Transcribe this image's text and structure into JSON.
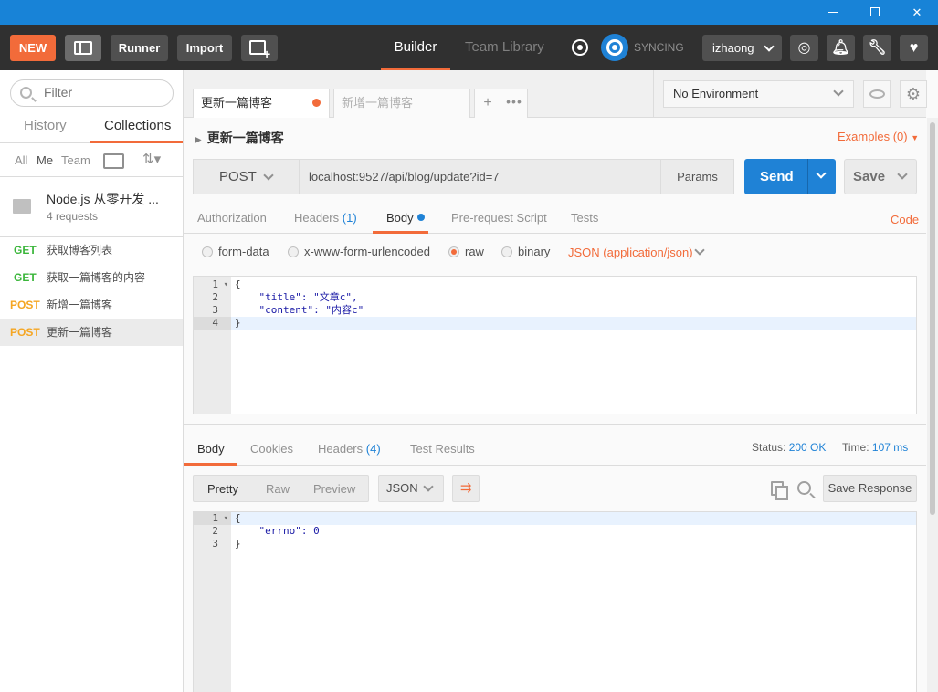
{
  "window": {
    "controls": [
      "minimize",
      "maximize",
      "close"
    ],
    "close_glyph": "✕"
  },
  "header": {
    "new_label": "NEW",
    "runner_label": "Runner",
    "import_label": "Import",
    "nav": {
      "builder": "Builder",
      "team_library": "Team Library"
    },
    "sync_label": "SYNCING",
    "user": "izhaong",
    "icons": [
      "layout-icon",
      "new-window-icon",
      "interceptor-icon",
      "sync-icon",
      "satellite-icon",
      "bell-icon",
      "wrench-icon",
      "heart-icon"
    ],
    "accent_color": "#f26b3a"
  },
  "sidebar": {
    "filter_placeholder": "Filter",
    "tabs": {
      "history": "History",
      "collections": "Collections"
    },
    "filters": {
      "all": "All",
      "me": "Me",
      "team": "Team"
    },
    "collection": {
      "name": "Node.js 从零开发 ...",
      "count": "4 requests"
    },
    "requests": [
      {
        "method": "GET",
        "name": "获取博客列表"
      },
      {
        "method": "GET",
        "name": "获取一篇博客的内容"
      },
      {
        "method": "POST",
        "name": "新增一篇博客"
      },
      {
        "method": "POST",
        "name": "更新一篇博客"
      }
    ]
  },
  "tabs": {
    "active": "更新一篇博客",
    "inactive": "新增一篇博客",
    "plus": "+",
    "more": "•••"
  },
  "environment": {
    "selected": "No Environment"
  },
  "request": {
    "title": "更新一篇博客",
    "examples": "Examples (0)",
    "method": "POST",
    "url": "localhost:9527/api/blog/update?id=7",
    "params_label": "Params",
    "send_label": "Send",
    "save_label": "Save",
    "tabs": {
      "authorization": "Authorization",
      "headers": "Headers",
      "headers_count": "(1)",
      "body": "Body",
      "prerequest": "Pre-request Script",
      "tests": "Tests",
      "code": "Code"
    },
    "body_modes": {
      "form_data": "form-data",
      "urlencoded": "x-www-form-urlencoded",
      "raw": "raw",
      "binary": "binary"
    },
    "selected_mode": "raw",
    "content_type": "JSON (application/json)",
    "body_lines": [
      "1",
      "2",
      "3",
      "4"
    ],
    "body_code": [
      "{",
      "    \"title\": \"文章c\",",
      "    \"content\": \"内容c\"",
      "}"
    ]
  },
  "response": {
    "tabs": {
      "body": "Body",
      "cookies": "Cookies",
      "headers": "Headers",
      "headers_count": "(4)",
      "test_results": "Test Results"
    },
    "status_label": "Status:",
    "status_value": "200 OK",
    "time_label": "Time:",
    "time_value": "107 ms",
    "formats": {
      "pretty": "Pretty",
      "raw": "Raw",
      "preview": "Preview"
    },
    "language": "JSON",
    "save_response": "Save Response",
    "lines": [
      "1",
      "2",
      "3"
    ],
    "code": [
      "{",
      "    \"errno\": 0",
      "}"
    ]
  }
}
